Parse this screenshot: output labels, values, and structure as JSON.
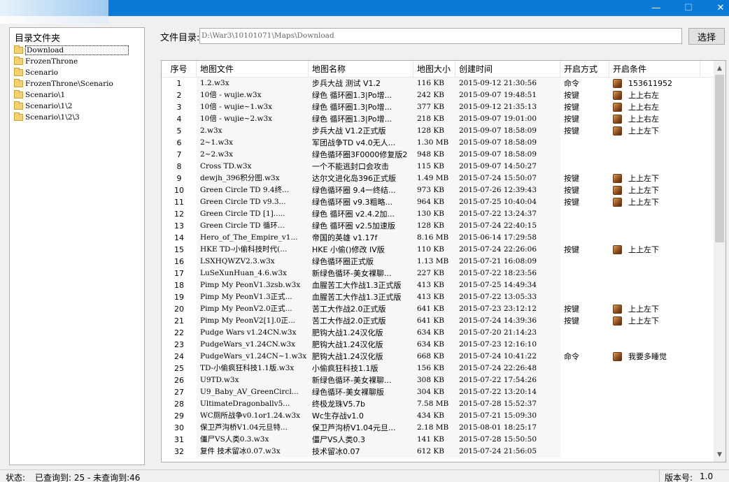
{
  "window": {
    "min_glyph": "—",
    "max_glyph": "☐",
    "close_glyph": "✕"
  },
  "dir_panel": {
    "header": "目录文件夹",
    "items": [
      {
        "label": "Download",
        "selected": true
      },
      {
        "label": "FrozenThrone"
      },
      {
        "label": "Scenario"
      },
      {
        "label": "FrozenThrone\\Scenario"
      },
      {
        "label": "Scenario\\1"
      },
      {
        "label": "Scenario\\1\\2"
      },
      {
        "label": "Scenario\\1\\2\\3"
      }
    ]
  },
  "path": {
    "label": "文件目录:",
    "value": "D:\\War3\\10101071\\Maps\\Download",
    "choose_button": "选择"
  },
  "table": {
    "columns": [
      "序号",
      "地图文件",
      "地图名称",
      "地图大小",
      "创建时间",
      "开启方式",
      "开启条件"
    ],
    "rows": [
      {
        "no": "1",
        "file": "1.2.w3x",
        "name": "步兵大战 测试 V1.2",
        "size": "116 KB",
        "time": "2015-09-12 21:30:56",
        "open": "命令",
        "cond": "153611952"
      },
      {
        "no": "2",
        "file": "10倍 - wujie.w3x",
        "name": "绿色 循环圈1.3|Po增...",
        "size": "242 KB",
        "time": "2015-09-07 19:48:51",
        "open": "按键",
        "cond": "上上右左"
      },
      {
        "no": "3",
        "file": "10倍 - wujie~1.w3x",
        "name": "绿色 循环圈1.3|Po增...",
        "size": "377 KB",
        "time": "2015-09-12 21:35:13",
        "open": "按键",
        "cond": "上上右左"
      },
      {
        "no": "4",
        "file": "10倍 - wujie~2.w3x",
        "name": "绿色 循环圈1.3|Po增...",
        "size": "218 KB",
        "time": "2015-09-07 19:01:00",
        "open": "按键",
        "cond": "上上右左"
      },
      {
        "no": "5",
        "file": "2.w3x",
        "name": "步兵大战 V1.2正式版",
        "size": "128 KB",
        "time": "2015-09-07 18:58:09",
        "open": "按键",
        "cond": "上上左下"
      },
      {
        "no": "6",
        "file": "2~1.w3x",
        "name": "军团战争TD v4.0无人...",
        "size": "1.30 MB",
        "time": "2015-09-07 18:58:09",
        "open": "",
        "cond": ""
      },
      {
        "no": "7",
        "file": "2~2.w3x",
        "name": "绿色循环圈3F0000修复版2",
        "size": "948 KB",
        "time": "2015-09-07 18:58:09",
        "open": "",
        "cond": ""
      },
      {
        "no": "8",
        "file": "Cross TD.w3x",
        "name": "一个不能逃封口会攻击",
        "size": "115 KB",
        "time": "2015-09-07 14:50:27",
        "open": "",
        "cond": ""
      },
      {
        "no": "9",
        "file": "dewjh_396积分图.w3x",
        "name": "达尔文进化岛396正式版",
        "size": "1.49 MB",
        "time": "2015-07-24 15:50:07",
        "open": "按键",
        "cond": "上上左下"
      },
      {
        "no": "10",
        "file": "Green Circle TD 9.4终...",
        "name": "绿色循环圈 9.4一终结...",
        "size": "973 KB",
        "time": "2015-07-26 12:39:43",
        "open": "按键",
        "cond": "上上左下"
      },
      {
        "no": "11",
        "file": "Green Circle TD v9.3...",
        "name": "绿色循环圈 v9.3粗略...",
        "size": "964 KB",
        "time": "2015-07-25 10:40:04",
        "open": "按键",
        "cond": "上上左下"
      },
      {
        "no": "12",
        "file": "Green Circle TD [1].....",
        "name": "绿色 循环圈 v2.4.2加...",
        "size": "130 KB",
        "time": "2015-07-22 13:24:37",
        "open": "",
        "cond": ""
      },
      {
        "no": "13",
        "file": "Green Circle TD 循环...",
        "name": "绿色 循环圈 v2.5加速版",
        "size": "128 KB",
        "time": "2015-07-24 22:40:15",
        "open": "",
        "cond": ""
      },
      {
        "no": "14",
        "file": "Hero_of_The_Empire_v1...",
        "name": "帝国的英雄 v1.17f",
        "size": "8.16 MB",
        "time": "2015-06-14 17:29:58",
        "open": "",
        "cond": ""
      },
      {
        "no": "15",
        "file": "HKE  TD-小偷科技时代(...",
        "name": "HKE 小偷()修改 IV版",
        "size": "110 KB",
        "time": "2015-07-24 22:26:06",
        "open": "按键",
        "cond": "上上左下"
      },
      {
        "no": "16",
        "file": "LSXHQWZV2.3.w3x",
        "name": "绿色循环圈正式版",
        "size": "1.13 MB",
        "time": "2015-07-21 16:08:09",
        "open": "",
        "cond": ""
      },
      {
        "no": "17",
        "file": "LuSeXunHuan_4.6.w3x",
        "name": "新绿色循环-美女裸聊...",
        "size": "227 KB",
        "time": "2015-07-22 18:23:56",
        "open": "",
        "cond": ""
      },
      {
        "no": "18",
        "file": "Pimp My PeonV1.3zsb.w3x",
        "name": "血腥苦工大作战1.3正式版",
        "size": "413 KB",
        "time": "2015-07-25 14:49:34",
        "open": "",
        "cond": ""
      },
      {
        "no": "19",
        "file": "Pimp My PeonV1.3正式...",
        "name": "血腥苦工大作战1.3正式版",
        "size": "413 KB",
        "time": "2015-07-22 13:05:33",
        "open": "",
        "cond": ""
      },
      {
        "no": "20",
        "file": "Pimp My PeonV2.0正式...",
        "name": "苦工大作战2.0正式版",
        "size": "641 KB",
        "time": "2015-07-23 23:12:12",
        "open": "按键",
        "cond": "上上左下"
      },
      {
        "no": "21",
        "file": "Pimp My PeonV2[1].0正...",
        "name": "苦工大作战2.0正式版",
        "size": "641 KB",
        "time": "2015-07-24 14:39:36",
        "open": "按键",
        "cond": "上上左下"
      },
      {
        "no": "22",
        "file": "Pudge Wars v1.24CN.w3x",
        "name": "肥钩大战1.24汉化版",
        "size": "634 KB",
        "time": "2015-07-20 21:14:23",
        "open": "",
        "cond": ""
      },
      {
        "no": "23",
        "file": "PudgeWars_v1.24CN.w3x",
        "name": "肥钩大战1.24汉化版",
        "size": "634 KB",
        "time": "2015-07-23 12:16:10",
        "open": "",
        "cond": ""
      },
      {
        "no": "24",
        "file": "PudgeWars_v1.24CN~1.w3x",
        "name": "肥钩大战1.24汉化版",
        "size": "668 KB",
        "time": "2015-07-24 10:41:22",
        "open": "命令",
        "cond": "我要多睡觉"
      },
      {
        "no": "25",
        "file": "TD-小偷疯狂科技1.1版.w3x",
        "name": "小偷疯狂科技1.1版",
        "size": "156 KB",
        "time": "2015-07-24 22:26:48",
        "open": "",
        "cond": ""
      },
      {
        "no": "26",
        "file": "U9TD.w3x",
        "name": "新绿色循环-美女裸聊...",
        "size": "308 KB",
        "time": "2015-07-22 17:54:26",
        "open": "",
        "cond": ""
      },
      {
        "no": "27",
        "file": "U9_Baby_AV_GreenCircl...",
        "name": "绿色循环-美女裸聊版",
        "size": "304 KB",
        "time": "2015-07-22 13:20:14",
        "open": "",
        "cond": ""
      },
      {
        "no": "28",
        "file": "UltimateDragonballv5...",
        "name": "终极龙珠V5.7b",
        "size": "7.58 MB",
        "time": "2015-07-28 15:52:37",
        "open": "",
        "cond": ""
      },
      {
        "no": "29",
        "file": "WC厕所战争v0.1or1.24.w3x",
        "name": "Wc生存战v1.0",
        "size": "434 KB",
        "time": "2015-07-21 15:09:30",
        "open": "",
        "cond": ""
      },
      {
        "no": "30",
        "file": "保卫芦沟桥V1.04元旦特...",
        "name": "保卫芦沟桥V1.04元旦...",
        "size": "2.18 MB",
        "time": "2015-08-01 18:25:17",
        "open": "",
        "cond": ""
      },
      {
        "no": "31",
        "file": "僵尸VS人类0.3.w3x",
        "name": "僵尸VS人类0.3",
        "size": "141 KB",
        "time": "2015-07-28 15:50:50",
        "open": "",
        "cond": ""
      },
      {
        "no": "32",
        "file": "复件 技术留冰0.07.w3x",
        "name": "技术留冰0.07",
        "size": "612 KB",
        "time": "2015-07-24 21:56:05",
        "open": "",
        "cond": ""
      }
    ]
  },
  "scrollbar": {
    "up_glyph": "▲",
    "down_glyph": "▼"
  },
  "status": {
    "label": "状态:",
    "text": "已查询到: 25 - 未查询到:46",
    "version_label": "版本号:",
    "version": "1.0"
  }
}
